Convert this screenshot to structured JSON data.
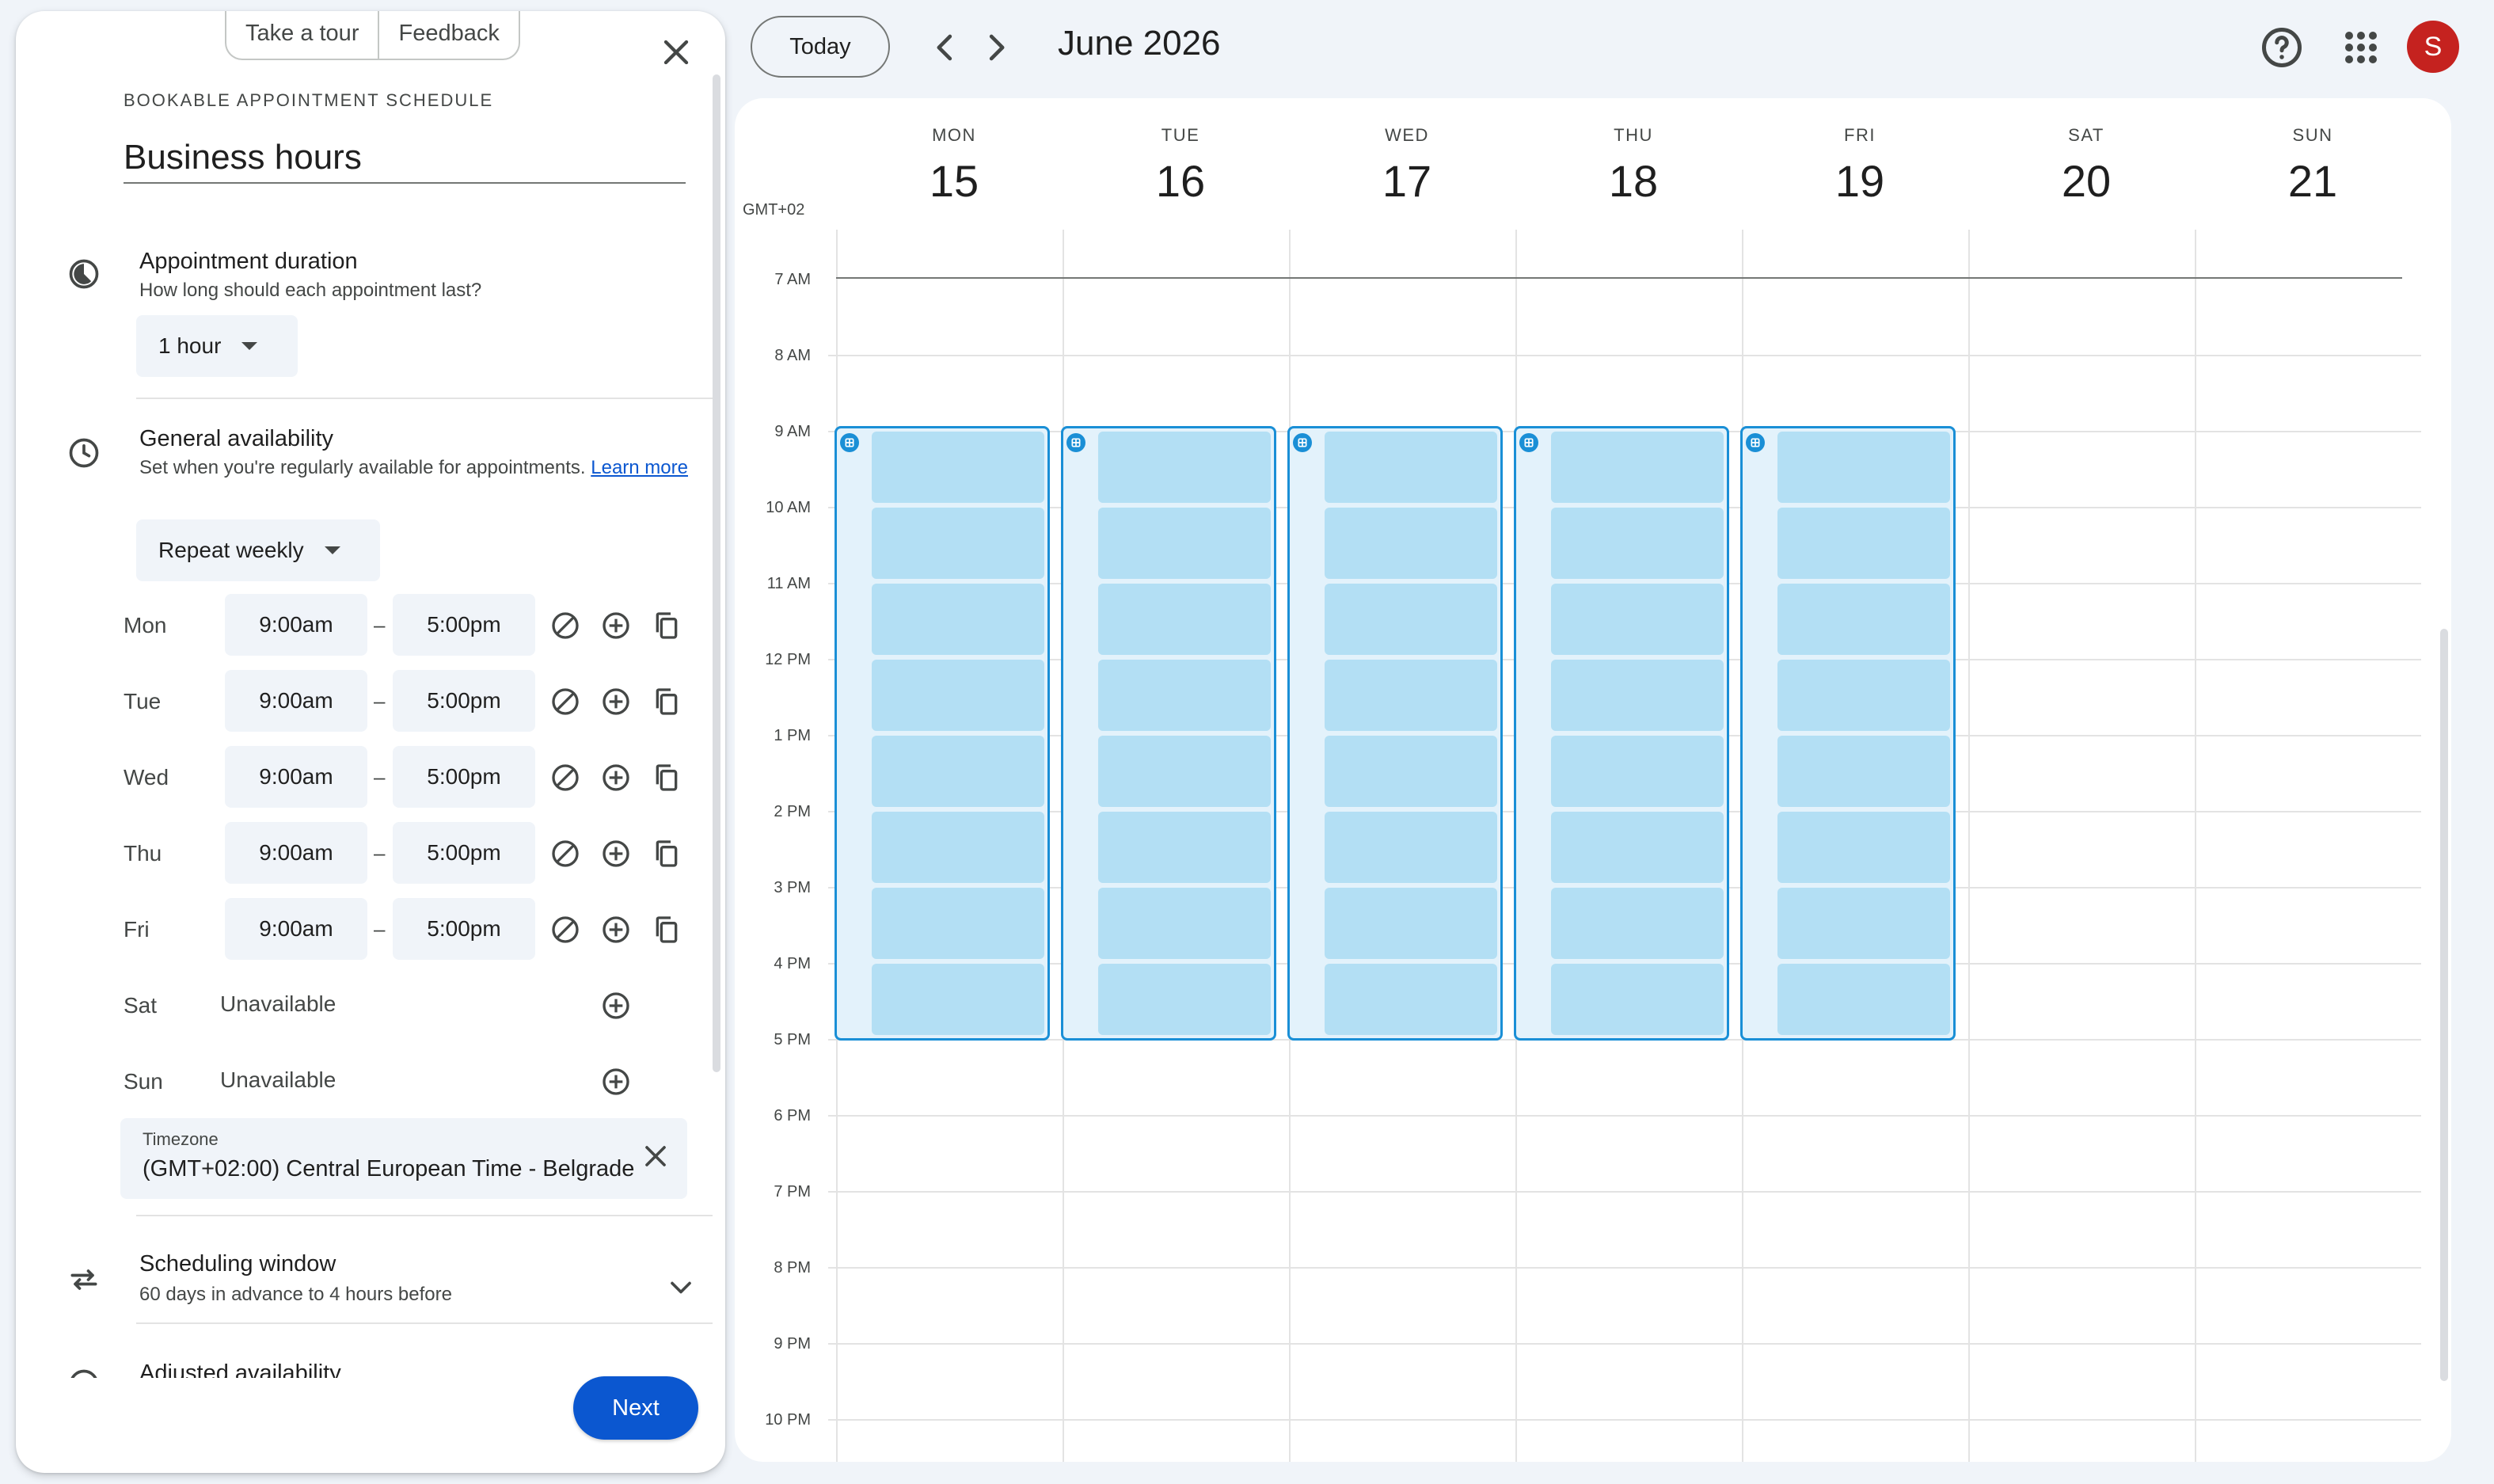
{
  "panel": {
    "tour_label": "Take a tour",
    "feedback_label": "Feedback",
    "eyebrow": "BOOKABLE APPOINTMENT SCHEDULE",
    "title": "Business hours",
    "duration": {
      "title": "Appointment duration",
      "subtitle": "How long should each appointment last?",
      "value": "1 hour"
    },
    "availability": {
      "title": "General availability",
      "subtitle": "Set when you're regularly available for appointments.",
      "learn_more": "Learn more",
      "repeat": "Repeat weekly",
      "dash": "–",
      "days": [
        {
          "label": "Mon",
          "start": "9:00am",
          "end": "5:00pm"
        },
        {
          "label": "Tue",
          "start": "9:00am",
          "end": "5:00pm"
        },
        {
          "label": "Wed",
          "start": "9:00am",
          "end": "5:00pm"
        },
        {
          "label": "Thu",
          "start": "9:00am",
          "end": "5:00pm"
        },
        {
          "label": "Fri",
          "start": "9:00am",
          "end": "5:00pm"
        },
        {
          "label": "Sat",
          "unavailable": "Unavailable"
        },
        {
          "label": "Sun",
          "unavailable": "Unavailable"
        }
      ]
    },
    "timezone": {
      "label": "Timezone",
      "value": "(GMT+02:00) Central European Time - Belgrade"
    },
    "scheduling_window": {
      "title": "Scheduling window",
      "subtitle": "60 days in advance to 4 hours before"
    },
    "adjusted_availability": {
      "title": "Adjusted availability"
    },
    "next_label": "Next"
  },
  "topbar": {
    "today_label": "Today",
    "month_title": "June 2026",
    "avatar_initial": "S",
    "icons": [
      "chevron-left-icon",
      "chevron-right-icon",
      "help-icon",
      "apps-grid-icon"
    ]
  },
  "calendar": {
    "timezone_tag": "GMT+02",
    "days": [
      {
        "dow": "MON",
        "num": "15"
      },
      {
        "dow": "TUE",
        "num": "16"
      },
      {
        "dow": "WED",
        "num": "17"
      },
      {
        "dow": "THU",
        "num": "18"
      },
      {
        "dow": "FRI",
        "num": "19"
      },
      {
        "dow": "SAT",
        "num": "20"
      },
      {
        "dow": "SUN",
        "num": "21"
      }
    ],
    "hours": [
      "7 AM",
      "8 AM",
      "9 AM",
      "10 AM",
      "11 AM",
      "12 PM",
      "1 PM",
      "2 PM",
      "3 PM",
      "4 PM",
      "5 PM",
      "6 PM",
      "7 PM",
      "8 PM",
      "9 PM",
      "10 PM"
    ],
    "availability_blocks": [
      {
        "day": "MON",
        "start": "9 AM",
        "end": "5 PM",
        "slots": 8
      },
      {
        "day": "TUE",
        "start": "9 AM",
        "end": "5 PM",
        "slots": 8
      },
      {
        "day": "WED",
        "start": "9 AM",
        "end": "5 PM",
        "slots": 8
      },
      {
        "day": "THU",
        "start": "9 AM",
        "end": "5 PM",
        "slots": 8
      },
      {
        "day": "FRI",
        "start": "9 AM",
        "end": "5 PM",
        "slots": 8
      }
    ],
    "colors": {
      "block_border": "#1a8fd6",
      "slot_fill": "#b3dff4",
      "block_bg": "#e3f2fb",
      "primary": "#0b57d0",
      "avatar": "#c5221f"
    }
  }
}
